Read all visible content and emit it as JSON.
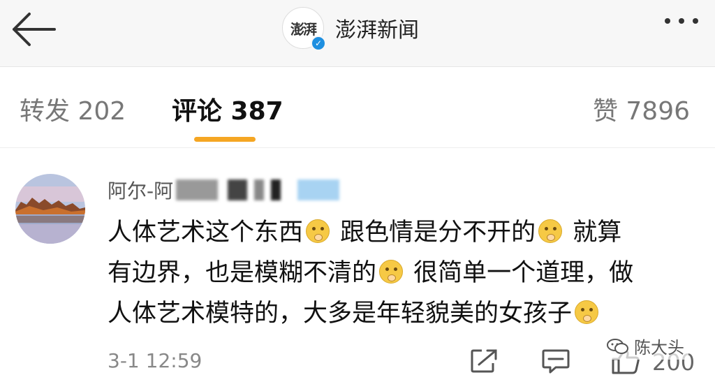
{
  "header": {
    "account_name": "澎湃新闻",
    "logo_text": "澎湃",
    "verified_mark": "✓",
    "icons": [
      "back-arrow-icon",
      "verified-icon",
      "more-icon"
    ]
  },
  "tabs": [
    {
      "label": "转发 202",
      "active": false
    },
    {
      "label": "评论 387",
      "active": true
    },
    {
      "label": "赞 7896",
      "active": false
    }
  ],
  "accent_color": "#f5a623",
  "comment": {
    "username": "阿尔-阿",
    "lines": [
      {
        "text_a": "人体艺术这个东西",
        "text_b": " 跟色情是分不开的",
        "text_c": " 就算"
      },
      {
        "text_a": "有边界，也是模糊不清的",
        "text_b": " 很简单一个道理，做"
      },
      {
        "text_a": "人体艺术模特的，大多是年轻貌美的女孩子"
      }
    ],
    "time": "3-1 12:59",
    "like_count": "200"
  },
  "watermark": {
    "text": "陈大头"
  }
}
